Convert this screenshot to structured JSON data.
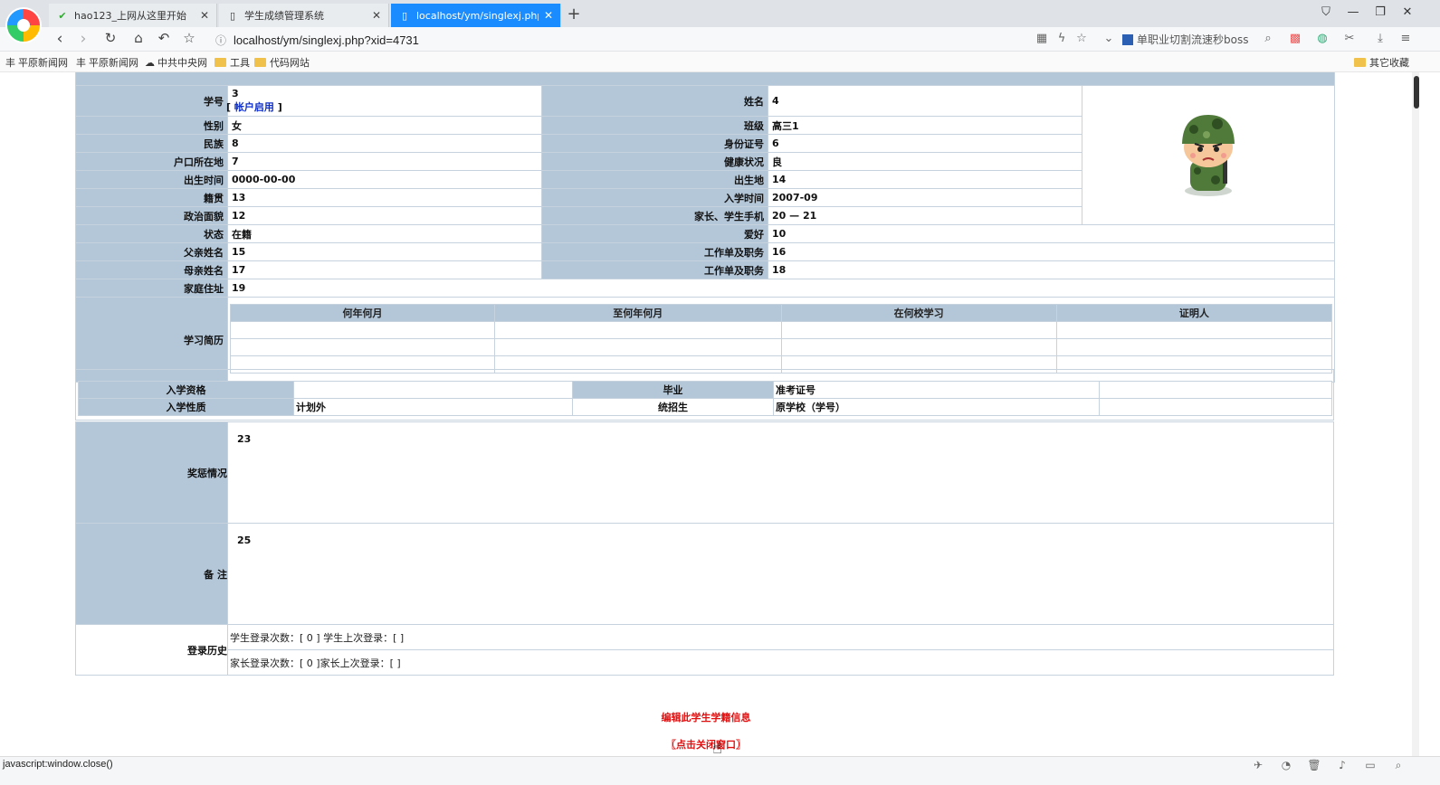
{
  "browser": {
    "tabs": [
      {
        "title": "hao123_上网从这里开始",
        "icon": "hao123-icon",
        "active": false
      },
      {
        "title": "学生成绩管理系统",
        "icon": "page-icon",
        "active": false
      },
      {
        "title": "localhost/ym/singlexj.php?xi",
        "icon": "page-icon",
        "active": true
      }
    ],
    "address": "localhost/ym/singlexj.php?xid=4731",
    "search_placeholder": "单职业切割流速秒boss",
    "bookmarks": [
      {
        "label": "平原新闻网",
        "icon": "site-icon"
      },
      {
        "label": "平原新闻网",
        "icon": "site-icon"
      },
      {
        "label": "中共中央网",
        "icon": "site-icon"
      },
      {
        "label": "工具",
        "icon": "folder-icon"
      },
      {
        "label": "代码网站",
        "icon": "folder-icon"
      }
    ],
    "other_bookmarks": "其它收藏",
    "status_text": "javascript:window.close()"
  },
  "student": {
    "labels": {
      "xuehao": "学号",
      "xingming": "姓名",
      "xingbie": "性别",
      "banji": "班级",
      "minzu": "民族",
      "sfz": "身份证号",
      "hukou": "户口所在地",
      "jiankang": "健康状况",
      "birthtime": "出生时间",
      "birthplace": "出生地",
      "jiguan": "籍贯",
      "ruxue": "入学时间",
      "zhengzhi": "政治面貌",
      "phone": "家长、学生手机",
      "zhuangtai": "状态",
      "aihao": "爱好",
      "father": "父亲姓名",
      "father_job": "工作单及职务",
      "mother": "母亲姓名",
      "mother_job": "工作单及职务",
      "address": "家庭住址",
      "resume": "学习简历"
    },
    "values": {
      "xuehao": "3",
      "account": "帐户启用",
      "xingming": "4",
      "xingbie": "女",
      "banji": "高三1",
      "minzu": "8",
      "sfz": "6",
      "hukou": "7",
      "jiankang": "良",
      "birthtime": "0000-00-00",
      "birthplace": "14",
      "jiguan": "13",
      "ruxue": "2007-09",
      "zhengzhi": "12",
      "phone": "20 — 21",
      "zhuangtai": "在籍",
      "aihao": "10",
      "father": "15",
      "father_job": "16",
      "mother": "17",
      "mother_job": "18",
      "address": "19"
    },
    "resume_headers": [
      "何年何月",
      "至何年何月",
      "在何校学习",
      "证明人"
    ],
    "admission": {
      "rxzg_label": "入学资格",
      "rxzg_value": "",
      "biye_label": "毕业",
      "zkzh_label": "准考证号",
      "zkzh_value": "",
      "rxxz_label": "入学性质",
      "rxxz_value": "计划外",
      "tzs_label": "统招生",
      "yxx_label": "原学校（学号）",
      "yxx_value": ""
    },
    "awards_label": "奖惩情况",
    "awards_value": "23",
    "remark_label": "备 注",
    "remark_value": "25",
    "login_label": "登录历史",
    "login_student": "学生登录次数：[ 0 ] 学生上次登录：[ ]",
    "login_parent": "家长登录次数：[ 0 ]家长上次登录：[ ]"
  },
  "actions": {
    "edit": "编辑此学生学籍信息",
    "close": "〖点击关闭窗口〗"
  }
}
